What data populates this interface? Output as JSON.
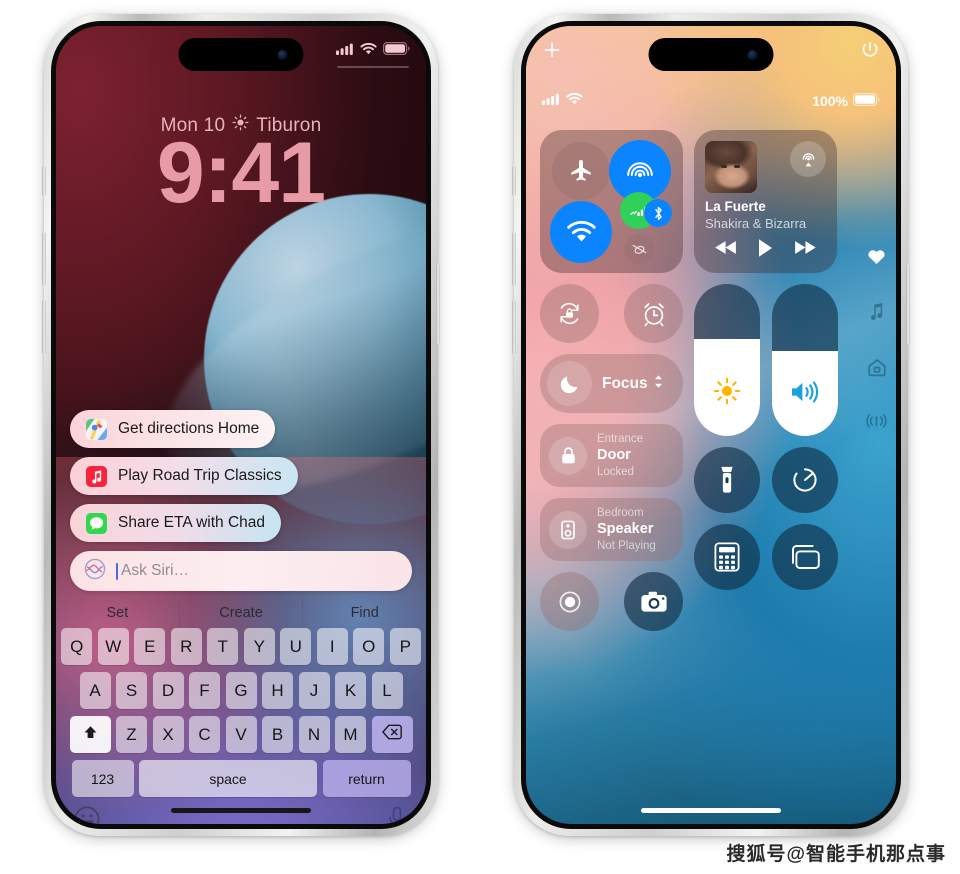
{
  "left_phone": {
    "status_bar": {
      "signal": "signal-bars",
      "wifi": "wifi",
      "battery": "battery-full"
    },
    "lock_screen": {
      "date": "Mon 10",
      "weather_icon": "sun-icon",
      "location": "Tiburon",
      "time": "9:41"
    },
    "siri_suggestions": [
      {
        "icon": "maps-app-icon",
        "label": "Get directions Home"
      },
      {
        "icon": "music-app-icon",
        "label": "Play Road Trip Classics"
      },
      {
        "icon": "messages-app-icon",
        "label": "Share ETA with Chad"
      }
    ],
    "ask_siri": {
      "icon": "siri-icon",
      "placeholder": "Ask Siri…",
      "value": ""
    },
    "predictive": [
      "Set",
      "Create",
      "Find"
    ],
    "keyboard": {
      "row1": [
        "Q",
        "W",
        "E",
        "R",
        "T",
        "Y",
        "U",
        "I",
        "O",
        "P"
      ],
      "row2": [
        "A",
        "S",
        "D",
        "F",
        "G",
        "H",
        "J",
        "K",
        "L"
      ],
      "row3": [
        "Z",
        "X",
        "C",
        "V",
        "B",
        "N",
        "M"
      ],
      "shift_icon": "shift-icon",
      "backspace_icon": "backspace-icon",
      "numbers_label": "123",
      "space_label": "space",
      "return_label": "return",
      "emoji_icon": "emoji-icon",
      "dictation_icon": "microphone-icon"
    }
  },
  "right_phone": {
    "top_bar": {
      "add_icon": "plus-icon",
      "power_icon": "power-icon"
    },
    "status_bar": {
      "signal": "signal-bars",
      "wifi": "wifi",
      "battery_percent": "100%",
      "battery_icon": "battery-full"
    },
    "connectivity": {
      "airplane": {
        "icon": "airplane-icon",
        "state": "off"
      },
      "airdrop": {
        "icon": "airdrop-icon",
        "state": "on"
      },
      "wifi": {
        "icon": "wifi-icon",
        "state": "on"
      },
      "cellular": {
        "icon": "cellular-icon",
        "state": "on"
      },
      "bluetooth": {
        "icon": "bluetooth-icon",
        "state": "on"
      },
      "hotspot": {
        "icon": "hotspot-icon",
        "state": "off"
      }
    },
    "now_playing": {
      "artwork": "album-artwork",
      "airplay_icon": "airplay-icon",
      "title": "La Fuerte",
      "artist": "Shakira & Bizarra",
      "rewind_icon": "rewind-icon",
      "play_icon": "play-icon",
      "forward_icon": "fast-forward-icon"
    },
    "quick_toggles": {
      "rotation_lock": "rotation-lock-icon",
      "alarm": "alarm-icon"
    },
    "focus": {
      "icon": "moon-icon",
      "label": "Focus",
      "chevron": "chevron-updown-icon"
    },
    "home_tiles": [
      {
        "icon": "lock-icon",
        "room": "Entrance",
        "name": "Door",
        "status": "Locked"
      },
      {
        "icon": "speaker-icon",
        "room": "Bedroom",
        "name": "Speaker",
        "status": "Not Playing"
      }
    ],
    "sliders": [
      {
        "name": "brightness",
        "icon": "brightness-icon",
        "value": 64
      },
      {
        "name": "volume",
        "icon": "volume-icon",
        "value": 56
      }
    ],
    "utility_buttons": [
      {
        "icon": "flashlight-icon",
        "name": "flashlight"
      },
      {
        "icon": "timer-icon",
        "name": "timer"
      },
      {
        "icon": "calculator-icon",
        "name": "calculator"
      },
      {
        "icon": "screen-mirroring-icon",
        "name": "screen-mirroring"
      },
      {
        "icon": "screen-record-icon",
        "name": "screen-record"
      },
      {
        "icon": "camera-icon",
        "name": "camera"
      }
    ],
    "page_indicators": [
      "heart-icon",
      "music-note-icon",
      "home-icon",
      "connectivity-icon"
    ]
  },
  "watermark": {
    "text": "搜狐号@智能手机那点事"
  },
  "colors": {
    "ios_blue": "#0a84ff",
    "ios_green": "#30d158",
    "lock_time": "#e79ba6",
    "music_red": "#fa233b",
    "messages_green": "#32d74b"
  }
}
